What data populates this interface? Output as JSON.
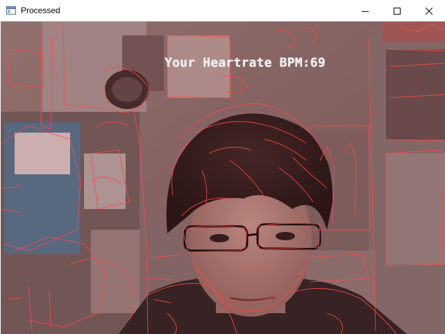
{
  "window": {
    "title": "Processed",
    "icon": "app-window-icon",
    "controls": [
      "minimize-icon",
      "maximize-icon",
      "close-icon"
    ]
  },
  "video": {
    "overlay_text": "Your Heartrate BPM:69",
    "edge_color": "#ff4a4a",
    "tint_color": "#7a4a4a"
  }
}
